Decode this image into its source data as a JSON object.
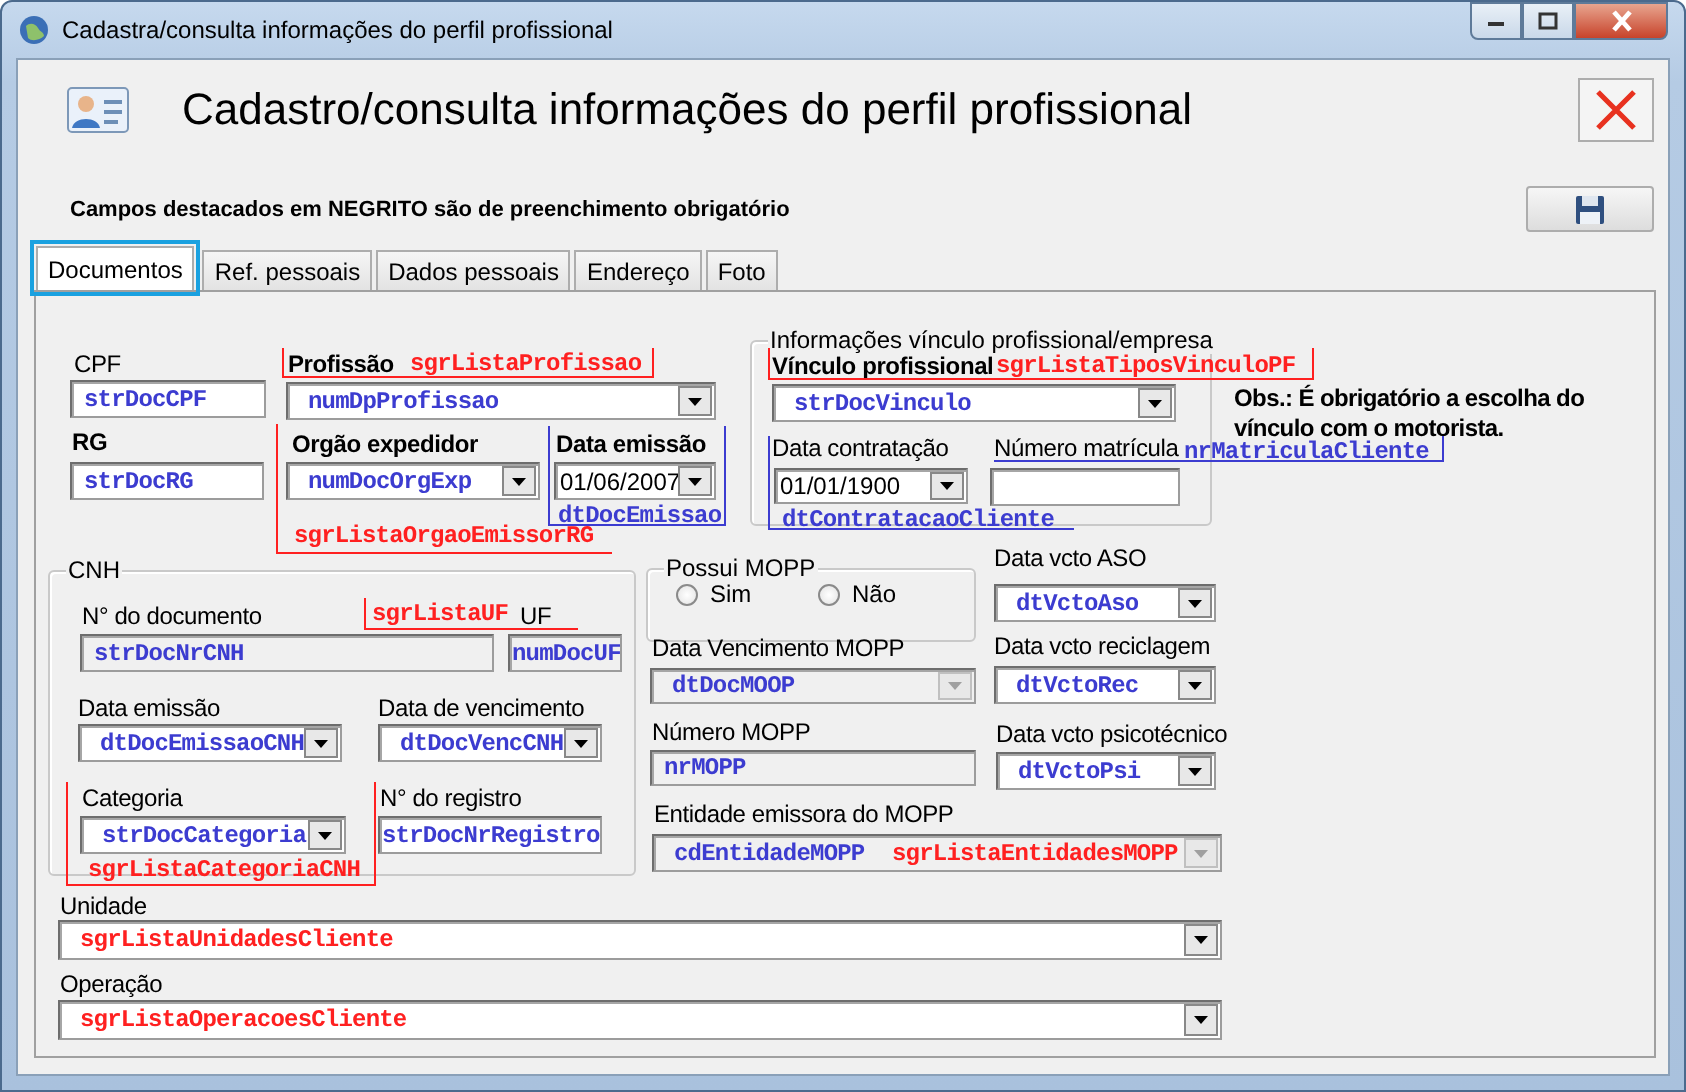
{
  "window": {
    "title": "Cadastra/consulta informações do perfil profissional"
  },
  "header": {
    "title": "Cadastro/consulta informações do perfil profissional"
  },
  "note": "Campos destacados em NEGRITO são de preenchimento obrigatório",
  "tabs": [
    {
      "label": "Documentos",
      "selected": true
    },
    {
      "label": "Ref. pessoais",
      "selected": false
    },
    {
      "label": "Dados pessoais",
      "selected": false
    },
    {
      "label": "Endereço",
      "selected": false
    },
    {
      "label": "Foto",
      "selected": false
    }
  ],
  "controls": [
    {
      "kind": "label",
      "text": "CPF",
      "required": false
    },
    {
      "kind": "text",
      "value": "strDocCPF",
      "color": "#3c3cd0",
      "disabled": false
    },
    {
      "kind": "label",
      "text": "Profissão",
      "required": true
    },
    {
      "kind": "annotation",
      "text": "sgrListaProfissao",
      "color": "#ff2020"
    },
    {
      "kind": "frame",
      "color": "#ff2020"
    },
    {
      "kind": "combo",
      "value": "numDpProfissao",
      "color": "#3c3cd0",
      "disabled": false
    },
    {
      "kind": "label",
      "text": "RG",
      "required": true
    },
    {
      "kind": "text",
      "value": "strDocRG",
      "color": "#3c3cd0",
      "disabled": false
    },
    {
      "kind": "label",
      "text": "Orgão expedidor",
      "required": true
    },
    {
      "kind": "combo",
      "value": "numDocOrgExp",
      "color": "#3c3cd0",
      "disabled": false
    },
    {
      "kind": "annotation",
      "text": "sgrListaOrgaoEmissorRG",
      "color": "#ff2020"
    },
    {
      "kind": "frame",
      "color": "#ff2020"
    },
    {
      "kind": "label",
      "text": "Data emissão",
      "required": true
    },
    {
      "kind": "combo",
      "value": "01/06/2007",
      "color": "#000000",
      "disabled": false
    },
    {
      "kind": "annotation",
      "text": "dtDocEmissao",
      "color": "#3c3cd0"
    },
    {
      "kind": "frame",
      "color": "#3c3cd0"
    },
    {
      "kind": "group",
      "text": "Informações vínculo profissional/empresa"
    },
    {
      "kind": "label",
      "text": "Vínculo profissional",
      "required": true
    },
    {
      "kind": "annotation",
      "text": "sgrListaTiposVinculoPF",
      "color": "#ff2020"
    },
    {
      "kind": "frame",
      "color": "#ff2020"
    },
    {
      "kind": "combo",
      "value": "strDocVinculo",
      "color": "#3c3cd0",
      "disabled": false
    },
    {
      "kind": "note",
      "text": "Obs.: É obrigatório a escolha do vínculo com o motorista."
    },
    {
      "kind": "label",
      "text": "Data contratação",
      "required": false
    },
    {
      "kind": "combo",
      "value": "01/01/1900",
      "color": "#000000",
      "disabled": false
    },
    {
      "kind": "annotation",
      "text": "dtContratacaoCliente",
      "color": "#3c3cd0"
    },
    {
      "kind": "frame",
      "color": "#3c3cd0"
    },
    {
      "kind": "label",
      "text": "Número matrícula",
      "required": false
    },
    {
      "kind": "text",
      "disabled": false
    },
    {
      "kind": "annotation",
      "text": "nrMatriculaCliente",
      "color": "#3c3cd0"
    },
    {
      "kind": "frame",
      "color": "#3c3cd0"
    },
    {
      "kind": "group",
      "text": "CNH"
    },
    {
      "kind": "label",
      "text": "N° do documento",
      "required": false
    },
    {
      "kind": "text",
      "value": "strDocNrCNH",
      "color": "#3c3cd0",
      "disabled": true
    },
    {
      "kind": "annotation",
      "text": "sgrListaUF",
      "color": "#ff2020"
    },
    {
      "kind": "label",
      "text": "UF",
      "required": false
    },
    {
      "kind": "frame",
      "color": "#ff2020"
    },
    {
      "kind": "text",
      "value": "numDocUF",
      "color": "#3c3cd0",
      "disabled": true
    },
    {
      "kind": "label",
      "text": "Data emissão",
      "required": false
    },
    {
      "kind": "combo",
      "value": "dtDocEmissaoCNH",
      "color": "#3c3cd0",
      "disabled": false
    },
    {
      "kind": "label",
      "text": "Data de vencimento",
      "required": false
    },
    {
      "kind": "combo",
      "value": "dtDocVencCNH",
      "color": "#3c3cd0",
      "disabled": false
    },
    {
      "kind": "label",
      "text": "Categoria",
      "required": false
    },
    {
      "kind": "combo",
      "value": "strDocCategoria",
      "color": "#3c3cd0",
      "disabled": false
    },
    {
      "kind": "annotation",
      "text": "sgrListaCategoriaCNH",
      "color": "#ff2020"
    },
    {
      "kind": "frame",
      "color": "#ff2020"
    },
    {
      "kind": "label",
      "text": "N° do registro",
      "required": false
    },
    {
      "kind": "text",
      "value": "strDocNrRegistro",
      "color": "#3c3cd0",
      "disabled": false
    },
    {
      "kind": "group",
      "text": "Possui MOPP"
    },
    {
      "kind": "radio",
      "text": "Sim",
      "selected": false
    },
    {
      "kind": "radio",
      "text": "Não",
      "selected": false
    },
    {
      "kind": "label",
      "text": "Data vcto ASO",
      "required": false
    },
    {
      "kind": "combo",
      "value": "dtVctoAso",
      "color": "#3c3cd0",
      "disabled": false
    },
    {
      "kind": "label",
      "text": "Data Vencimento MOPP",
      "required": false
    },
    {
      "kind": "combo",
      "value": "dtDocMOOP",
      "color": "#3c3cd0",
      "disabled": true
    },
    {
      "kind": "label",
      "text": "Data vcto reciclagem",
      "required": false
    },
    {
      "kind": "combo",
      "value": "dtVctoRec",
      "color": "#3c3cd0",
      "disabled": false
    },
    {
      "kind": "label",
      "text": "Número MOPP",
      "required": false
    },
    {
      "kind": "text",
      "value": "nrMOPP",
      "color": "#3c3cd0",
      "disabled": true
    },
    {
      "kind": "label",
      "text": "Data vcto psicotécnico",
      "required": false
    },
    {
      "kind": "combo",
      "value": "dtVctoPsi",
      "color": "#3c3cd0",
      "disabled": false
    },
    {
      "kind": "label",
      "text": "Entidade emissora do MOPP",
      "required": false
    },
    {
      "kind": "combo",
      "value": "cdEntidadeMOPP",
      "color": "#3c3cd0",
      "disabled": true
    },
    {
      "kind": "annotation",
      "text": "sgrListaEntidadesMOPP",
      "color": "#ff2020"
    },
    {
      "kind": "label",
      "text": "Unidade",
      "required": false
    },
    {
      "kind": "combo",
      "value": "sgrListaUnidadesCliente",
      "color": "#ff2020",
      "disabled": false
    },
    {
      "kind": "label",
      "text": "Operação",
      "required": false
    },
    {
      "kind": "combo",
      "value": "sgrListaOperacoesCliente",
      "color": "#ff2020",
      "disabled": false
    }
  ]
}
